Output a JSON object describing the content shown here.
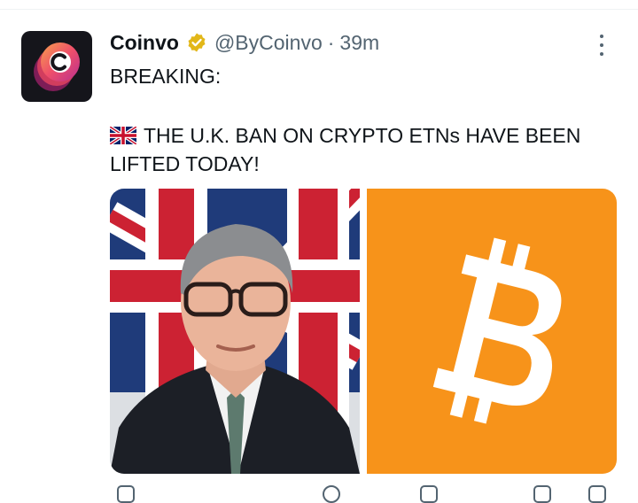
{
  "tweet": {
    "author_name": "Coinvo",
    "handle": "@ByCoinvo",
    "separator": "·",
    "time": "39m",
    "line1": "BREAKING:",
    "line2": "THE U.K. BAN ON CRYPTO ETNs HAVE BEEN",
    "line3": "LIFTED TODAY!"
  },
  "icons": {
    "avatar": "coinvo-logo",
    "verified": "verified-badge-icon",
    "flag": "uk-flag-icon",
    "more": "more-vertical-icon",
    "bitcoin": "bitcoin-logo"
  },
  "colors": {
    "bitcoin_orange": "#F7931A",
    "verified_gold": "#E2B719",
    "muted_text": "#536471"
  }
}
